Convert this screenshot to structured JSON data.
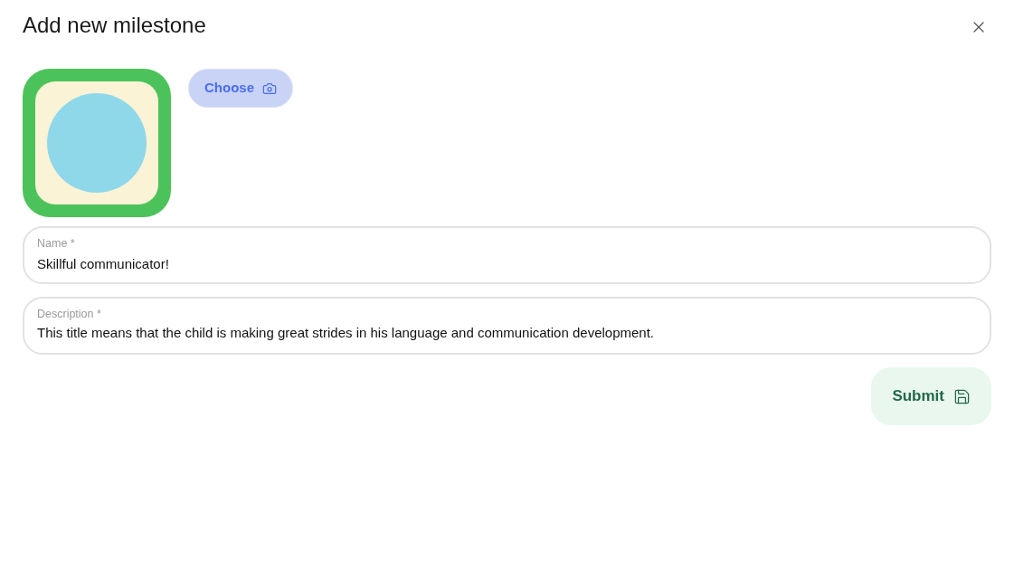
{
  "dialog": {
    "title": "Add new milestone"
  },
  "image": {
    "choose_button": "Choose"
  },
  "fields": [
    {
      "kind": "input",
      "label": "Name *",
      "value": "Skillful communicator!"
    },
    {
      "kind": "textarea",
      "label": "Description *",
      "value": "This title means that the child is making great strides in his language and communication development."
    }
  ],
  "submit_button": "Submit"
}
